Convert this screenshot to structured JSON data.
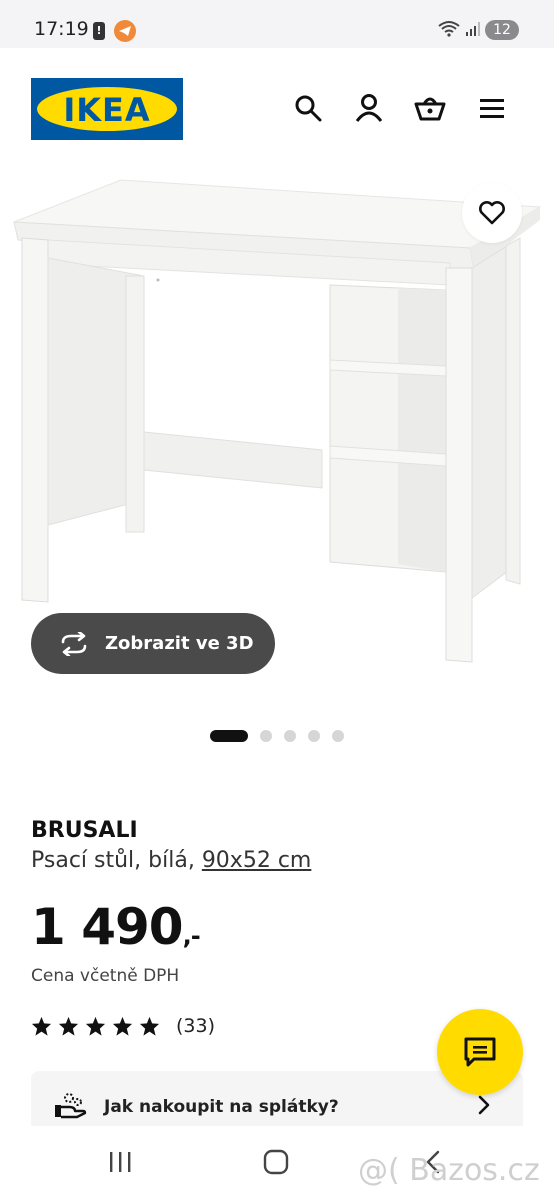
{
  "status_bar": {
    "time": "17:19",
    "alert": "!",
    "notification_count": "12"
  },
  "brand": {
    "logo_text": "IKEA",
    "colors": {
      "blue": "#0058a3",
      "yellow": "#ffdb00"
    }
  },
  "header": {
    "icons": [
      "search-icon",
      "profile-icon",
      "basket-icon",
      "menu-icon"
    ]
  },
  "gallery": {
    "view_3d_label": "Zobrazit ve 3D",
    "image_count": 5,
    "active_index": 0
  },
  "product": {
    "name": "BRUSALI",
    "description": "Psací stůl, bílá, ",
    "size": "90x52 cm",
    "price": "1 490",
    "price_suffix": ",-",
    "price_note": "Cena včetně DPH",
    "rating_stars": 5,
    "review_count": "(33)"
  },
  "installments": {
    "label": "Jak nakoupit na splátky?"
  },
  "watermark": "@( Bazos.cz"
}
